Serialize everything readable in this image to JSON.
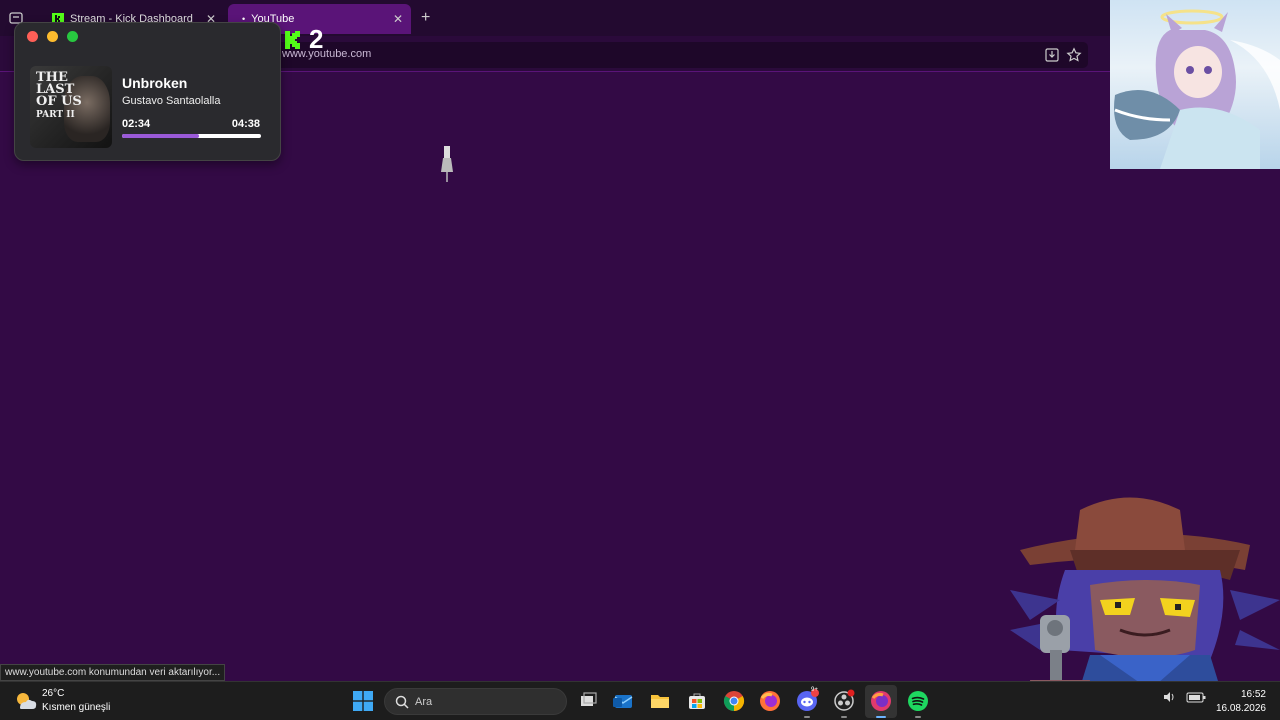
{
  "browser": {
    "tabs": [
      {
        "label": "Stream - Kick Dashboard",
        "active": false
      },
      {
        "label": "YouTube",
        "active": true
      }
    ],
    "url": "www.youtube.com",
    "status_text": "www.youtube.com konumundan veri aktarılıyor..."
  },
  "kick_overlay": {
    "count": "2",
    "color": "#53fc18"
  },
  "music_widget": {
    "title": "Unbroken",
    "artist": "Gustavo Santaolalla",
    "elapsed": "02:34",
    "total": "04:38",
    "progress_fraction": 0.554,
    "album_text": "THE LAST OF US PART II",
    "accent": "#9a5ad8"
  },
  "taskbar": {
    "weather": {
      "temp": "26°C",
      "condition": "Kısmen güneşli"
    },
    "search_placeholder": "Ara",
    "apps": [
      "task-view",
      "outlook",
      "file-explorer",
      "microsoft-store",
      "chrome",
      "firefox",
      "discord",
      "obs",
      "firefox-dev",
      "spotify"
    ],
    "discord_badge": "9+",
    "clock": {
      "time": "16:52",
      "date": "16.08.2026"
    }
  },
  "colors": {
    "page_bg": "#330a45",
    "tab_active": "#5a1478",
    "tabbar": "#230a30"
  }
}
